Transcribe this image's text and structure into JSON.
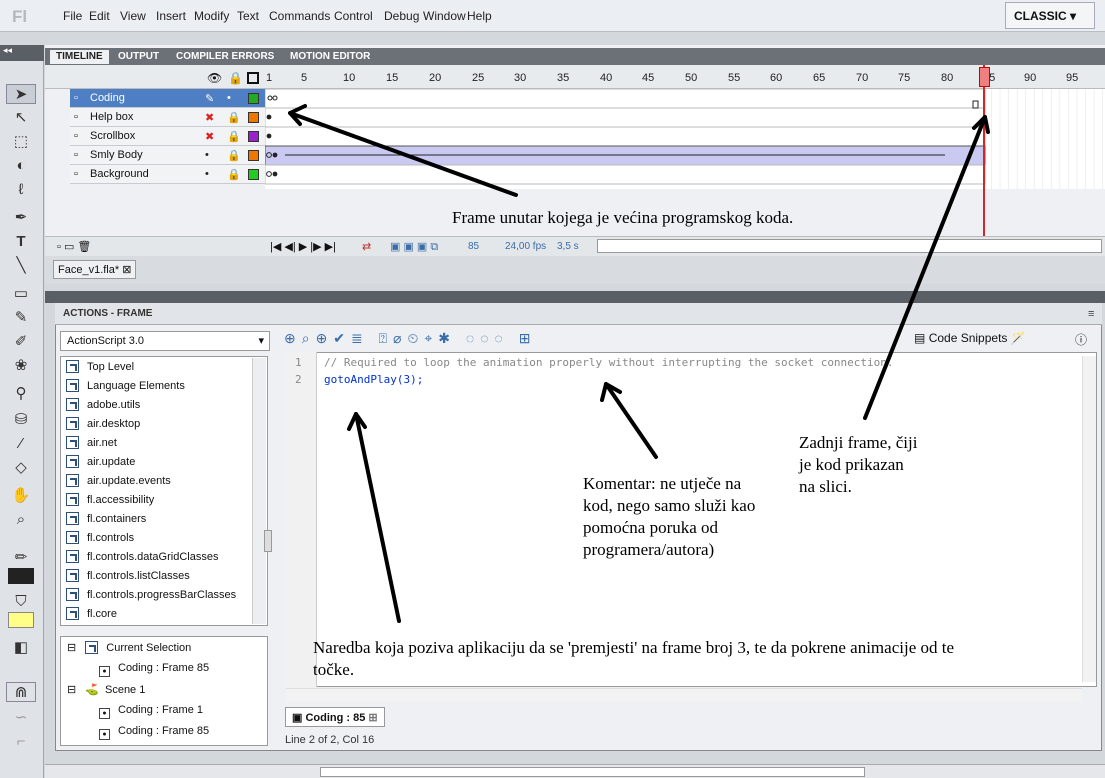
{
  "app": {
    "logo": "Fl",
    "workspace": "CLASSIC"
  },
  "menu": [
    "File",
    "Edit",
    "View",
    "Insert",
    "Modify",
    "Text",
    "Commands",
    "Control",
    "Debug",
    "Window",
    "Help"
  ],
  "timeline": {
    "tabs": [
      "TIMELINE",
      "OUTPUT",
      "COMPILER ERRORS",
      "MOTION EDITOR"
    ],
    "frame_numbers": [
      "1",
      "5",
      "10",
      "15",
      "20",
      "25",
      "30",
      "35",
      "40",
      "45",
      "50",
      "55",
      "60",
      "65",
      "70",
      "75",
      "80",
      "85",
      "90",
      "95"
    ],
    "layers": [
      {
        "name": "Coding",
        "selected": true,
        "color": "#22aa22"
      },
      {
        "name": "Help box",
        "selected": false,
        "color": "#ee7700"
      },
      {
        "name": "Scrollbox",
        "selected": false,
        "color": "#9922cc"
      },
      {
        "name": "Smly Body",
        "selected": false,
        "color": "#ee7700"
      },
      {
        "name": "Background",
        "selected": false,
        "color": "#22cc22"
      }
    ],
    "current_frame": "85",
    "fps": "24,00 fps",
    "time": "3,5 s"
  },
  "document": {
    "tab": "Face_v1.fla*"
  },
  "actions": {
    "title": "ACTIONS - FRAME",
    "language": "ActionScript 3.0",
    "code_snippets": "Code Snippets",
    "library": [
      "Top Level",
      "Language Elements",
      "adobe.utils",
      "air.desktop",
      "air.net",
      "air.update",
      "air.update.events",
      "fl.accessibility",
      "fl.containers",
      "fl.controls",
      "fl.controls.dataGridClasses",
      "fl.controls.listClasses",
      "fl.controls.progressBarClasses",
      "fl.core"
    ],
    "script_tree": [
      {
        "label": "Current Selection",
        "indent": 0,
        "kind": "book"
      },
      {
        "label": "Coding : Frame 85",
        "indent": 1,
        "kind": "frame"
      },
      {
        "label": "Scene 1",
        "indent": 0,
        "kind": "scene"
      },
      {
        "label": "Coding : Frame 1",
        "indent": 1,
        "kind": "frame"
      },
      {
        "label": "Coding : Frame 85",
        "indent": 1,
        "kind": "frame"
      }
    ],
    "code_lines": [
      {
        "no": "1",
        "text": "// Required to loop the animation properly without interrupting the socket connection."
      },
      {
        "no": "2",
        "text": "gotoAndPlay(3);"
      }
    ],
    "code_tab": "Coding : 85",
    "status": "Line 2 of 2, Col 16"
  },
  "annotations": {
    "frame_note": "Frame unutar kojega je većina programskog koda.",
    "last_frame": "Zadnji frame, čiji je kod prikazan na slici.",
    "comment_note": "Komentar: ne utječe na kod, nego samo služi kao pomoćna poruka od programera/autora)",
    "command_note": "Naredba koja poziva aplikaciju da se 'premjesti' na frame broj 3, te da pokrene animacije od te točke."
  }
}
